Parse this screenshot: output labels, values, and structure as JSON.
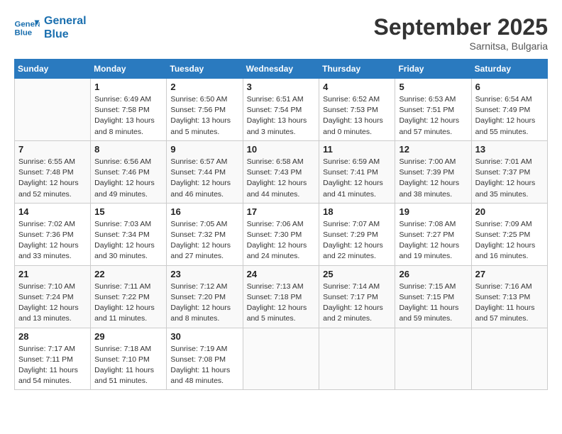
{
  "logo": {
    "line1": "General",
    "line2": "Blue"
  },
  "title": "September 2025",
  "location": "Sarnitsa, Bulgaria",
  "weekdays": [
    "Sunday",
    "Monday",
    "Tuesday",
    "Wednesday",
    "Thursday",
    "Friday",
    "Saturday"
  ],
  "weeks": [
    [
      {
        "day": "",
        "info": ""
      },
      {
        "day": "1",
        "info": "Sunrise: 6:49 AM\nSunset: 7:58 PM\nDaylight: 13 hours\nand 8 minutes."
      },
      {
        "day": "2",
        "info": "Sunrise: 6:50 AM\nSunset: 7:56 PM\nDaylight: 13 hours\nand 5 minutes."
      },
      {
        "day": "3",
        "info": "Sunrise: 6:51 AM\nSunset: 7:54 PM\nDaylight: 13 hours\nand 3 minutes."
      },
      {
        "day": "4",
        "info": "Sunrise: 6:52 AM\nSunset: 7:53 PM\nDaylight: 13 hours\nand 0 minutes."
      },
      {
        "day": "5",
        "info": "Sunrise: 6:53 AM\nSunset: 7:51 PM\nDaylight: 12 hours\nand 57 minutes."
      },
      {
        "day": "6",
        "info": "Sunrise: 6:54 AM\nSunset: 7:49 PM\nDaylight: 12 hours\nand 55 minutes."
      }
    ],
    [
      {
        "day": "7",
        "info": "Sunrise: 6:55 AM\nSunset: 7:48 PM\nDaylight: 12 hours\nand 52 minutes."
      },
      {
        "day": "8",
        "info": "Sunrise: 6:56 AM\nSunset: 7:46 PM\nDaylight: 12 hours\nand 49 minutes."
      },
      {
        "day": "9",
        "info": "Sunrise: 6:57 AM\nSunset: 7:44 PM\nDaylight: 12 hours\nand 46 minutes."
      },
      {
        "day": "10",
        "info": "Sunrise: 6:58 AM\nSunset: 7:43 PM\nDaylight: 12 hours\nand 44 minutes."
      },
      {
        "day": "11",
        "info": "Sunrise: 6:59 AM\nSunset: 7:41 PM\nDaylight: 12 hours\nand 41 minutes."
      },
      {
        "day": "12",
        "info": "Sunrise: 7:00 AM\nSunset: 7:39 PM\nDaylight: 12 hours\nand 38 minutes."
      },
      {
        "day": "13",
        "info": "Sunrise: 7:01 AM\nSunset: 7:37 PM\nDaylight: 12 hours\nand 35 minutes."
      }
    ],
    [
      {
        "day": "14",
        "info": "Sunrise: 7:02 AM\nSunset: 7:36 PM\nDaylight: 12 hours\nand 33 minutes."
      },
      {
        "day": "15",
        "info": "Sunrise: 7:03 AM\nSunset: 7:34 PM\nDaylight: 12 hours\nand 30 minutes."
      },
      {
        "day": "16",
        "info": "Sunrise: 7:05 AM\nSunset: 7:32 PM\nDaylight: 12 hours\nand 27 minutes."
      },
      {
        "day": "17",
        "info": "Sunrise: 7:06 AM\nSunset: 7:30 PM\nDaylight: 12 hours\nand 24 minutes."
      },
      {
        "day": "18",
        "info": "Sunrise: 7:07 AM\nSunset: 7:29 PM\nDaylight: 12 hours\nand 22 minutes."
      },
      {
        "day": "19",
        "info": "Sunrise: 7:08 AM\nSunset: 7:27 PM\nDaylight: 12 hours\nand 19 minutes."
      },
      {
        "day": "20",
        "info": "Sunrise: 7:09 AM\nSunset: 7:25 PM\nDaylight: 12 hours\nand 16 minutes."
      }
    ],
    [
      {
        "day": "21",
        "info": "Sunrise: 7:10 AM\nSunset: 7:24 PM\nDaylight: 12 hours\nand 13 minutes."
      },
      {
        "day": "22",
        "info": "Sunrise: 7:11 AM\nSunset: 7:22 PM\nDaylight: 12 hours\nand 11 minutes."
      },
      {
        "day": "23",
        "info": "Sunrise: 7:12 AM\nSunset: 7:20 PM\nDaylight: 12 hours\nand 8 minutes."
      },
      {
        "day": "24",
        "info": "Sunrise: 7:13 AM\nSunset: 7:18 PM\nDaylight: 12 hours\nand 5 minutes."
      },
      {
        "day": "25",
        "info": "Sunrise: 7:14 AM\nSunset: 7:17 PM\nDaylight: 12 hours\nand 2 minutes."
      },
      {
        "day": "26",
        "info": "Sunrise: 7:15 AM\nSunset: 7:15 PM\nDaylight: 11 hours\nand 59 minutes."
      },
      {
        "day": "27",
        "info": "Sunrise: 7:16 AM\nSunset: 7:13 PM\nDaylight: 11 hours\nand 57 minutes."
      }
    ],
    [
      {
        "day": "28",
        "info": "Sunrise: 7:17 AM\nSunset: 7:11 PM\nDaylight: 11 hours\nand 54 minutes."
      },
      {
        "day": "29",
        "info": "Sunrise: 7:18 AM\nSunset: 7:10 PM\nDaylight: 11 hours\nand 51 minutes."
      },
      {
        "day": "30",
        "info": "Sunrise: 7:19 AM\nSunset: 7:08 PM\nDaylight: 11 hours\nand 48 minutes."
      },
      {
        "day": "",
        "info": ""
      },
      {
        "day": "",
        "info": ""
      },
      {
        "day": "",
        "info": ""
      },
      {
        "day": "",
        "info": ""
      }
    ]
  ]
}
